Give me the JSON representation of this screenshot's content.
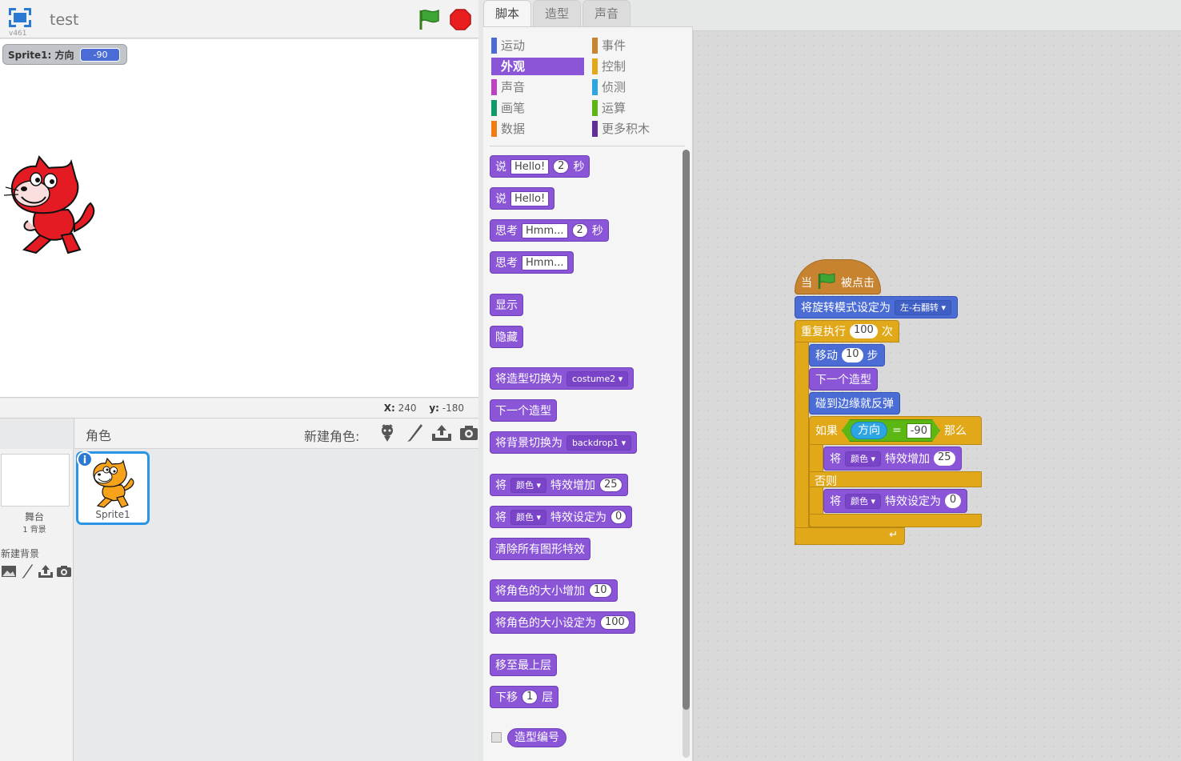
{
  "stage": {
    "version": "v461",
    "project_title": "test",
    "monitor": {
      "label": "Sprite1: 方向",
      "value": "-90"
    },
    "coords": {
      "x_label": "X:",
      "x_value": "240",
      "y_label": "y:",
      "y_value": "-180"
    }
  },
  "sprite_pane": {
    "sprites_label": "角色",
    "new_sprite_label": "新建角色:",
    "stage_caption": "舞台",
    "backdrop_count": "1 背景",
    "new_backdrop_label": "新建背景",
    "sprites": [
      {
        "name": "Sprite1"
      }
    ]
  },
  "tabs": [
    {
      "label": "脚本",
      "active": true
    },
    {
      "label": "造型",
      "active": false
    },
    {
      "label": "声音",
      "active": false
    }
  ],
  "categories": [
    {
      "label": "运动",
      "color": "#4a6cd4"
    },
    {
      "label": "外观",
      "color": "#8a55d7",
      "selected": true
    },
    {
      "label": "声音",
      "color": "#bb42c3"
    },
    {
      "label": "画笔",
      "color": "#0e9a6c"
    },
    {
      "label": "数据",
      "color": "#ee7d16"
    },
    {
      "label": "事件",
      "color": "#c88330"
    },
    {
      "label": "控制",
      "color": "#e1a91a"
    },
    {
      "label": "侦测",
      "color": "#2ca5e2"
    },
    {
      "label": "运算",
      "color": "#5cb712"
    },
    {
      "label": "更多积木",
      "color": "#632d99"
    }
  ],
  "palette_blocks": {
    "say_secs": {
      "a": "说",
      "text": "Hello!",
      "secs": "2",
      "b": "秒"
    },
    "say": {
      "a": "说",
      "text": "Hello!"
    },
    "think_secs": {
      "a": "思考",
      "text": "Hmm...",
      "secs": "2",
      "b": "秒"
    },
    "think": {
      "a": "思考",
      "text": "Hmm..."
    },
    "show": "显示",
    "hide": "隐藏",
    "switch_costume": {
      "a": "将造型切换为",
      "value": "costume2"
    },
    "next_costume": "下一个造型",
    "switch_backdrop": {
      "a": "将背景切换为",
      "value": "backdrop1"
    },
    "change_effect": {
      "a": "将",
      "effect": "颜色",
      "b": "特效增加",
      "value": "25"
    },
    "set_effect": {
      "a": "将",
      "effect": "颜色",
      "b": "特效设定为",
      "value": "0"
    },
    "clear_effects": "清除所有图形特效",
    "change_size": {
      "a": "将角色的大小增加",
      "value": "10"
    },
    "set_size": {
      "a": "将角色的大小设定为",
      "value": "100"
    },
    "go_front": "移至最上层",
    "go_back": {
      "a": "下移",
      "value": "1",
      "b": "层"
    },
    "costume_number": "造型编号"
  },
  "script": {
    "when_flag": {
      "a": "当",
      "b": "被点击"
    },
    "rotation_style": {
      "a": "将旋转模式设定为",
      "value": "左-右翻转"
    },
    "repeat": {
      "a": "重复执行",
      "value": "100",
      "b": "次"
    },
    "move": {
      "a": "移动",
      "value": "10",
      "b": "步"
    },
    "next_costume": "下一个造型",
    "bounce": "碰到边缘就反弹",
    "if": {
      "a": "如果",
      "reporter": "方向",
      "op": "=",
      "value": "-90",
      "b": "那么"
    },
    "change_effect": {
      "a": "将",
      "effect": "颜色",
      "b": "特效增加",
      "value": "25"
    },
    "else": "否则",
    "set_effect": {
      "a": "将",
      "effect": "颜色",
      "b": "特效设定为",
      "value": "0"
    }
  }
}
